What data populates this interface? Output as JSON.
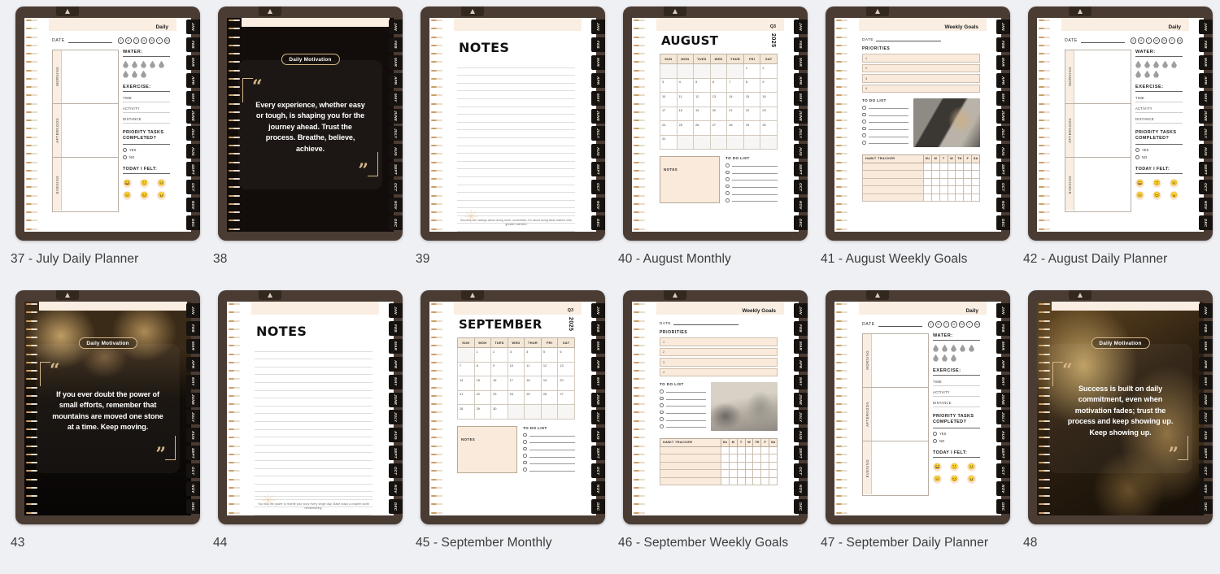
{
  "gallery": {
    "items": [
      {
        "caption": "37 - July Daily Planner",
        "type": "daily",
        "header": "Daily",
        "date_label": "DATE",
        "day_dots": [
          "S",
          "M",
          "T",
          "W",
          "TH",
          "F",
          "SA"
        ],
        "segments": [
          "MORNING",
          "AFTERNOON",
          "EVENING"
        ],
        "water_label": "WATER:",
        "exercise_label": "EXERCISE:",
        "exercise_fields": [
          "TIME",
          "ACTIVITY",
          "DISTANCE"
        ],
        "priority_label": "PRIORITY TASKS COMPLETED?",
        "priority_options": [
          "YES",
          "NO"
        ],
        "felt_label": "TODAY I FELT:",
        "faces": [
          "😄",
          "🙂",
          "😐",
          "😑",
          "😣",
          "😠"
        ]
      },
      {
        "caption": "38",
        "type": "quote",
        "badge": "Daily Motivation",
        "quote": "Every experience, whether easy or tough, is shaping you for the journey ahead. Trust the process. Breathe, believe, achieve.",
        "bg": "b1"
      },
      {
        "caption": "39",
        "type": "notes",
        "title": "NOTES",
        "line_count": 22,
        "footer": "Success isn't always about doing more; sometimes, it's about doing what matters with greater intention"
      },
      {
        "caption": "40 - August Monthly",
        "type": "monthly",
        "quarter": "Q3",
        "month": "AUGUST",
        "year": "2025",
        "weekdays": [
          "SUN",
          "MON",
          "TUES",
          "WED",
          "THUR",
          "FRI",
          "SAT"
        ],
        "lead_blanks": 5,
        "days_in_month": 31,
        "notes_label": "NOTES",
        "todo_label": "TO DO LIST",
        "todo_count": 6
      },
      {
        "caption": "41 - August Weekly Goals",
        "type": "weekly",
        "header": "Weekly Goals",
        "date_label": "DATE",
        "priorities_label": "PRIORITIES",
        "priorities": [
          "1",
          "2",
          "3",
          "4"
        ],
        "todo_label": "TO DO LIST",
        "todo_count": 6,
        "habit_label": "HABIT TRACKER",
        "habit_days": [
          "SU",
          "M",
          "T",
          "W",
          "TH",
          "F",
          "SA"
        ],
        "habit_rows": 5,
        "photo": "ph1"
      },
      {
        "caption": "42 - August Daily Planner",
        "type": "daily",
        "header": "Daily",
        "date_label": "DATE",
        "day_dots": [
          "S",
          "M",
          "T",
          "W",
          "TH",
          "F",
          "SA"
        ],
        "segments": [
          "MORNING",
          "AFTERNOON",
          "EVENING"
        ],
        "water_label": "WATER:",
        "exercise_label": "EXERCISE:",
        "exercise_fields": [
          "TIME",
          "ACTIVITY",
          "DISTANCE"
        ],
        "priority_label": "PRIORITY TASKS COMPLETED?",
        "priority_options": [
          "YES",
          "NO"
        ],
        "felt_label": "TODAY I FELT:",
        "faces": [
          "😄",
          "🙂",
          "😐",
          "😑",
          "😣",
          "😠"
        ]
      },
      {
        "caption": "43",
        "type": "quote",
        "badge": "Daily Motivation",
        "quote": "If you ever doubt the power of small efforts, remember that mountains are moved one stone at a time. Keep moving.",
        "bg": "b2"
      },
      {
        "caption": "44",
        "type": "notes",
        "title": "NOTES",
        "line_count": 22,
        "footer": "You hold the power to rewrite your story every single day. Make today a chapter worth remembering."
      },
      {
        "caption": "45 - September Monthly",
        "type": "monthly",
        "quarter": "Q3",
        "month": "SEPTEMBER",
        "year": "2025",
        "weekdays": [
          "SUN",
          "MON",
          "TUES",
          "WED",
          "THUR",
          "FRI",
          "SAT"
        ],
        "lead_blanks": 1,
        "days_in_month": 30,
        "notes_label": "NOTES",
        "todo_label": "TO DO LIST",
        "todo_count": 6
      },
      {
        "caption": "46 - September Weekly Goals",
        "type": "weekly",
        "header": "Weekly Goals",
        "date_label": "DATE",
        "priorities_label": "PRIORITIES",
        "priorities": [
          "1",
          "2",
          "3",
          "4"
        ],
        "todo_label": "TO DO LIST",
        "todo_count": 6,
        "habit_label": "HABIT TRACKER",
        "habit_days": [
          "SU",
          "M",
          "T",
          "W",
          "TH",
          "F",
          "SA"
        ],
        "habit_rows": 5,
        "photo": "ph2"
      },
      {
        "caption": "47 - September Daily Planner",
        "type": "daily",
        "header": "Daily",
        "date_label": "DATE",
        "day_dots": [
          "S",
          "M",
          "T",
          "W",
          "TH",
          "F",
          "SA"
        ],
        "segments": [
          "MORNING",
          "AFTERNOON",
          "EVENING"
        ],
        "water_label": "WATER:",
        "exercise_label": "EXERCISE:",
        "exercise_fields": [
          "TIME",
          "ACTIVITY",
          "DISTANCE"
        ],
        "priority_label": "PRIORITY TASKS COMPLETED?",
        "priority_options": [
          "YES",
          "NO"
        ],
        "felt_label": "TODAY I FELT:",
        "faces": [
          "😄",
          "🙂",
          "😐",
          "😑",
          "😣",
          "😠"
        ]
      },
      {
        "caption": "48",
        "type": "quote",
        "badge": "Daily Motivation",
        "quote": "Success is built on daily commitment, even when motivation fades; trust the process and keep showing up. Keep showing up.",
        "bg": "b3"
      }
    ],
    "month_tabs": [
      "JAN",
      "FEB",
      "MAR",
      "APR",
      "MAY",
      "JUNE",
      "JULY",
      "AUG",
      "SEPT",
      "OCT",
      "NOV",
      "DEC"
    ],
    "colors": {
      "page_bg": "#eff0f4",
      "cover": "#4a3c33",
      "accent_cream": "#faeadb",
      "gold": "#d8b88a",
      "caption_text": "#3c3c3c"
    }
  }
}
